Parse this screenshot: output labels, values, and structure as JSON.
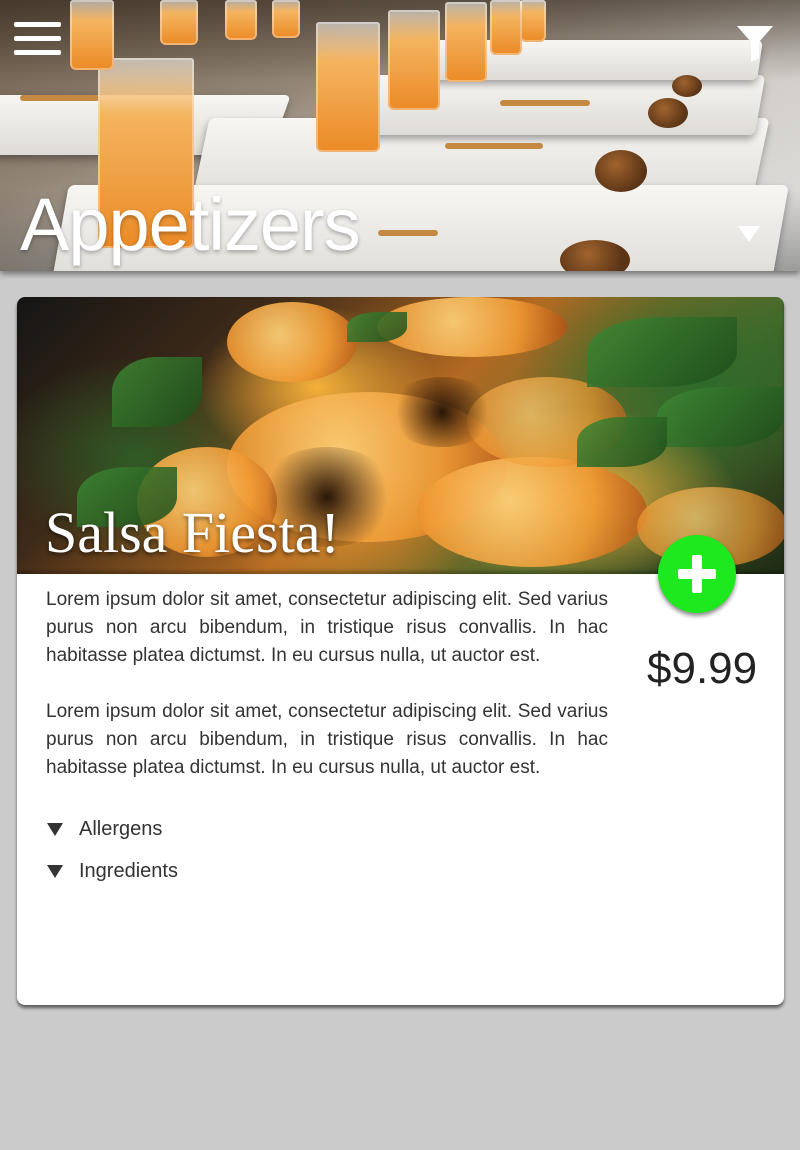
{
  "header": {
    "title": "Appetizers",
    "menu_icon": "hamburger-menu-icon",
    "filter_icon": "filter-funnel-icon",
    "title_caret_icon": "caret-down-icon"
  },
  "item": {
    "name": "Salsa Fiesta!",
    "price": "$9.99",
    "add_icon": "plus-icon",
    "accent_color": "#1ee81e",
    "description": [
      "Lorem ipsum dolor sit amet, consectetur adipiscing elit. Sed varius purus non arcu bibendum, in tristique risus convallis. In hac habitasse platea dictumst. In eu cursus nulla, ut auctor est.",
      "Lorem ipsum dolor sit amet, consectetur adipiscing elit. Sed varius purus non arcu bibendum, in tristique risus convallis. In hac habitasse platea dictumst. In eu cursus nulla, ut auctor est."
    ],
    "sections": [
      {
        "label": "Allergens",
        "icon": "caret-down-icon"
      },
      {
        "label": "Ingredients",
        "icon": "caret-down-icon"
      }
    ]
  }
}
